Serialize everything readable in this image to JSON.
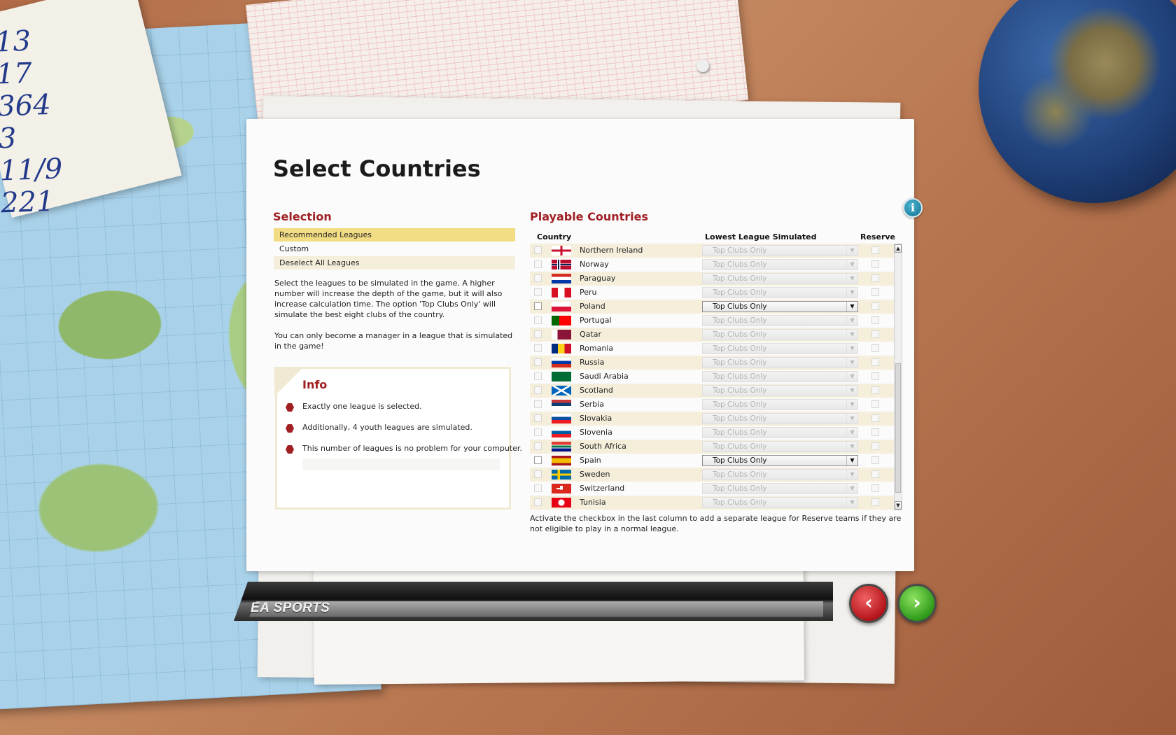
{
  "page_title": "Select Countries",
  "selection": {
    "title": "Selection",
    "items": [
      {
        "label": "Recommended Leagues",
        "state": "selected"
      },
      {
        "label": "Custom",
        "state": "normal"
      },
      {
        "label": "Deselect All Leagues",
        "state": "normal"
      }
    ],
    "description_1": "Select the leagues to be simulated in the game. A higher number will increase the depth of the game, but it will also increase calculation time. The option 'Top Clubs Only' will simulate the best eight clubs of the country.",
    "description_2": "You can only become a manager in a league that is simulated in the game!"
  },
  "info": {
    "title": "Info",
    "lines": [
      "Exactly one league is selected.",
      "Additionally, 4 youth leagues are simulated.",
      "This number of leagues is no problem for your computer."
    ]
  },
  "playable": {
    "title": "Playable Countries",
    "headers": {
      "country": "Country",
      "league": "Lowest League Simulated",
      "reserve": "Reserve"
    },
    "rows": [
      {
        "country": "Northern Ireland",
        "league": "Top Clubs Only",
        "enabled": false,
        "flag": "northern-ireland"
      },
      {
        "country": "Norway",
        "league": "Top Clubs Only",
        "enabled": false,
        "flag": "norway"
      },
      {
        "country": "Paraguay",
        "league": "Top Clubs Only",
        "enabled": false,
        "flag": "paraguay"
      },
      {
        "country": "Peru",
        "league": "Top Clubs Only",
        "enabled": false,
        "flag": "peru"
      },
      {
        "country": "Poland",
        "league": "Top Clubs Only",
        "enabled": true,
        "flag": "poland"
      },
      {
        "country": "Portugal",
        "league": "Top Clubs Only",
        "enabled": false,
        "flag": "portugal"
      },
      {
        "country": "Qatar",
        "league": "Top Clubs Only",
        "enabled": false,
        "flag": "qatar"
      },
      {
        "country": "Romania",
        "league": "Top Clubs Only",
        "enabled": false,
        "flag": "romania"
      },
      {
        "country": "Russia",
        "league": "Top Clubs Only",
        "enabled": false,
        "flag": "russia"
      },
      {
        "country": "Saudi Arabia",
        "league": "Top Clubs Only",
        "enabled": false,
        "flag": "saudi-arabia"
      },
      {
        "country": "Scotland",
        "league": "Top Clubs Only",
        "enabled": false,
        "flag": "scotland"
      },
      {
        "country": "Serbia",
        "league": "Top Clubs Only",
        "enabled": false,
        "flag": "serbia"
      },
      {
        "country": "Slovakia",
        "league": "Top Clubs Only",
        "enabled": false,
        "flag": "slovakia"
      },
      {
        "country": "Slovenia",
        "league": "Top Clubs Only",
        "enabled": false,
        "flag": "slovenia"
      },
      {
        "country": "South Africa",
        "league": "Top Clubs Only",
        "enabled": false,
        "flag": "south-africa"
      },
      {
        "country": "Spain",
        "league": "Top Clubs Only",
        "enabled": true,
        "flag": "spain"
      },
      {
        "country": "Sweden",
        "league": "Top Clubs Only",
        "enabled": false,
        "flag": "sweden"
      },
      {
        "country": "Switzerland",
        "league": "Top Clubs Only",
        "enabled": false,
        "flag": "switzerland"
      },
      {
        "country": "Tunisia",
        "league": "Top Clubs Only",
        "enabled": false,
        "flag": "tunisia"
      }
    ],
    "footnote": "Activate the checkbox in the last column to add a separate league for Reserve teams if they are not eligible to play in a normal league."
  },
  "footer": {
    "brand": "EA SPORTS",
    "back_icon": "chevron-left-icon",
    "next_icon": "chevron-right-icon"
  },
  "note_scribble": "13\n17\n364\n3\n11/9\n221",
  "colors": {
    "accent_red": "#a01f23",
    "selection_highlight": "#f3dd84",
    "stripe": "#f4eedb",
    "back_button": "#c8151b",
    "next_button": "#36a61e"
  }
}
